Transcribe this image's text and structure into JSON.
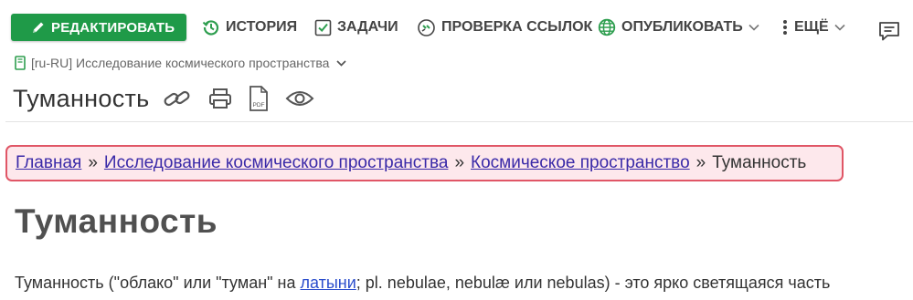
{
  "toolbar": {
    "edit_label": "РЕДАКТИРОВАТЬ",
    "history_label": "ИСТОРИЯ",
    "tasks_label": "ЗАДАЧИ",
    "links_label": "ПРОВЕРКА ССЫЛОК",
    "publish_label": "ОПУБЛИКОВАТЬ",
    "more_label": "ЕЩЁ"
  },
  "space": {
    "label": "[ru-RU] Исследование космического пространства"
  },
  "page": {
    "title": "Туманность"
  },
  "breadcrumb": {
    "items": [
      "Главная",
      "Исследование космического пространства",
      "Космическое пространство"
    ],
    "separator": "»",
    "current": "Туманность"
  },
  "content": {
    "title": "Туманность",
    "paragraph_before": "Туманность (\"облако\" или \"туман\" на ",
    "paragraph_link": "латыни",
    "paragraph_after": "; pl. nebulae, nebulæ или nebulas) - это ярко светящаяся часть"
  },
  "colors": {
    "edit_button": "#1f9a48",
    "breadcrumb_bg": "#fde8ec",
    "breadcrumb_border": "#e05666",
    "link": "#3a2aa8",
    "icon_green": "#2e9e4f"
  },
  "icons": [
    "pencil-icon",
    "history-icon",
    "checkbox-icon",
    "link-check-icon",
    "globe-icon",
    "kebab-icon",
    "comment-icon",
    "book-icon",
    "link-icon",
    "print-icon",
    "pdf-icon",
    "eye-icon"
  ]
}
